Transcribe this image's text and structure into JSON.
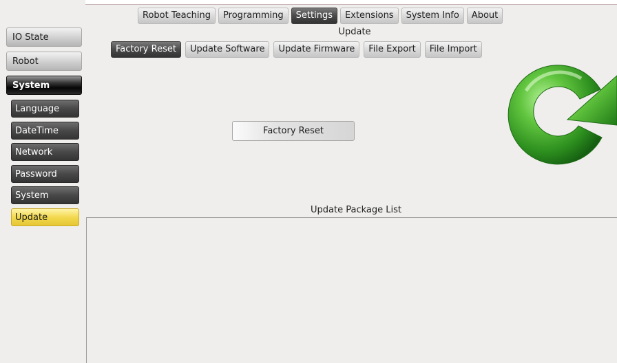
{
  "top_nav": {
    "tabs": [
      {
        "label": "Robot Teaching"
      },
      {
        "label": "Programming"
      },
      {
        "label": "Settings",
        "active": true
      },
      {
        "label": "Extensions"
      },
      {
        "label": "System Info"
      },
      {
        "label": "About"
      }
    ]
  },
  "section": {
    "title": "Update"
  },
  "sub_nav": {
    "tabs": [
      {
        "label": "Factory Reset",
        "active": true
      },
      {
        "label": "Update Software"
      },
      {
        "label": "Update Firmware"
      },
      {
        "label": "File Export"
      },
      {
        "label": "File Import"
      }
    ]
  },
  "sidebar": {
    "main_items": [
      {
        "label": "IO State"
      },
      {
        "label": "Robot"
      },
      {
        "label": "System",
        "active": true
      }
    ],
    "sub_items": [
      {
        "label": "Language"
      },
      {
        "label": "DateTime"
      },
      {
        "label": "Network"
      },
      {
        "label": "Password"
      },
      {
        "label": "System"
      },
      {
        "label": "Update",
        "selected": true
      }
    ]
  },
  "main": {
    "factory_reset_label": "Factory Reset",
    "list_title": "Update Package List",
    "icon": "refresh-icon"
  },
  "colors": {
    "selected": "#f2d94f",
    "dark_button": "#3a3a3a",
    "icon_green": "#3aa12a"
  }
}
